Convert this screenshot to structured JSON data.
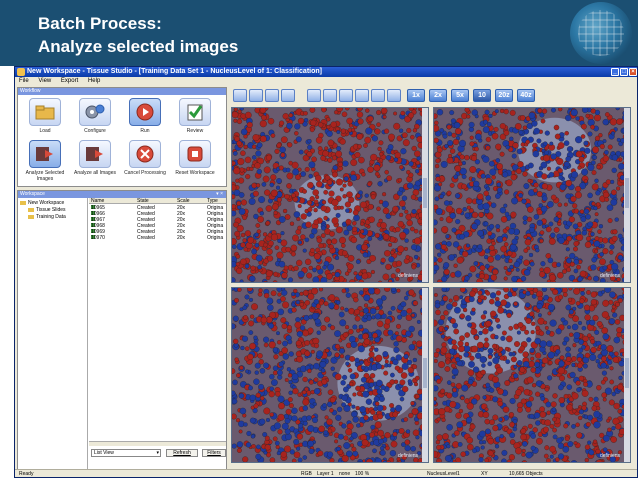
{
  "slide": {
    "title_line1": "Batch Process:",
    "title_line2": "Analyze selected images"
  },
  "window": {
    "title": "New Workspace - Tissue Studio - [Training Data Set 1 - NucleusLevel of 1: Classification]",
    "controls": [
      "_",
      "□",
      "×"
    ]
  },
  "menu": [
    "File",
    "View",
    "Export",
    "Help"
  ],
  "workflow": {
    "header": "Workflow",
    "row1": [
      {
        "label": "Load",
        "icon": "folder-open-icon"
      },
      {
        "label": "Configure",
        "icon": "gears-icon"
      },
      {
        "label": "Run",
        "icon": "play-icon"
      },
      {
        "label": "Review",
        "icon": "checklist-icon"
      }
    ],
    "row2": [
      {
        "label": "Analyze Selected Images",
        "icon": "analyze-selected-icon"
      },
      {
        "label": "Analyze all Images",
        "icon": "analyze-all-icon"
      },
      {
        "label": "Cancel Processing",
        "icon": "cancel-icon"
      },
      {
        "label": "Reset Workspace",
        "icon": "reset-icon"
      }
    ]
  },
  "workspace": {
    "header": "Workspace",
    "tree": [
      "New Workspace",
      "Tissue Slides",
      "Training Data"
    ],
    "columns": [
      "Name",
      "State",
      "Scale",
      "Type"
    ],
    "rows": [
      [
        "10965",
        "Created",
        "20x",
        "Origina"
      ],
      [
        "10966",
        "Created",
        "20x",
        "Origina"
      ],
      [
        "10967",
        "Created",
        "20x",
        "Origina"
      ],
      [
        "10968",
        "Created",
        "20x",
        "Origina"
      ],
      [
        "10969",
        "Created",
        "20x",
        "Origina"
      ],
      [
        "10970",
        "Created",
        "20x",
        "Origina"
      ]
    ],
    "view_mode": "List View",
    "refresh_label": "Refresh",
    "filters_label": "Filters"
  },
  "toolbar": {
    "zoom_levels": [
      "1x",
      "2x",
      "5x",
      "10",
      "20z",
      "40z"
    ]
  },
  "viewports": {
    "label": "definiens"
  },
  "status": {
    "left": "Ready",
    "color_mode": "RGB",
    "layer": "Layer 1",
    "none": "none",
    "zoom": "100 %",
    "level": "NucleusLevel1",
    "xy": "XY",
    "objects": "10,665 Objects"
  },
  "colors": {
    "slide_header": "#1b4f72",
    "nucleus_red": "#a8231e",
    "nucleus_blue": "#1f3a9e",
    "titlebar": "#0a3aa8"
  }
}
